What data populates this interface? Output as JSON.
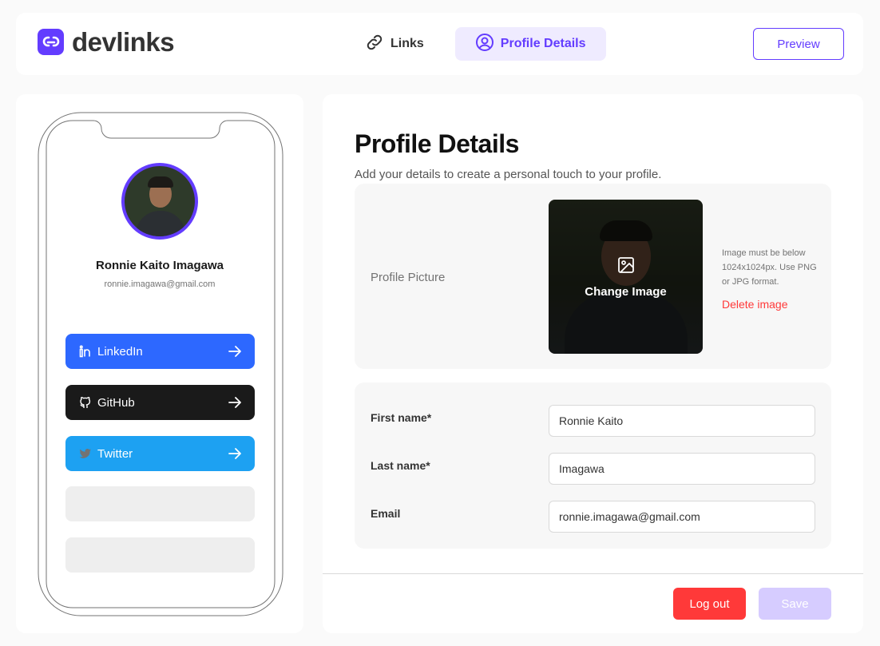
{
  "header": {
    "logo_text": "devlinks",
    "tabs": [
      {
        "label": "Links",
        "icon": "link-icon"
      },
      {
        "label": "Profile Details",
        "icon": "user-circle-icon"
      }
    ],
    "preview_label": "Preview"
  },
  "preview": {
    "name": "Ronnie Kaito Imagawa",
    "email": "ronnie.imagawa@gmail.com",
    "links": [
      {
        "platform": "LinkedIn",
        "color": "#2d68ff",
        "icon": "linkedin-icon"
      },
      {
        "platform": "GitHub",
        "color": "#1a1a1a",
        "icon": "github-icon"
      },
      {
        "platform": "Twitter",
        "color": "#1da1f2",
        "icon": "twitter-icon"
      }
    ]
  },
  "profile": {
    "title": "Profile Details",
    "subtitle": "Add your details to create a personal touch to your profile.",
    "picture_label": "Profile Picture",
    "change_image_label": "Change Image",
    "picture_note": "Image must be below 1024x1024px. Use PNG or JPG format.",
    "delete_label": "Delete image",
    "fields": {
      "first_name": {
        "label": "First name*",
        "value": "Ronnie Kaito"
      },
      "last_name": {
        "label": "Last name*",
        "value": "Imagawa"
      },
      "email": {
        "label": "Email",
        "value": "ronnie.imagawa@gmail.com"
      }
    },
    "logout_label": "Log out",
    "save_label": "Save"
  },
  "colors": {
    "accent": "#633cff",
    "accent_light": "#efebff",
    "danger": "#ff3939"
  }
}
